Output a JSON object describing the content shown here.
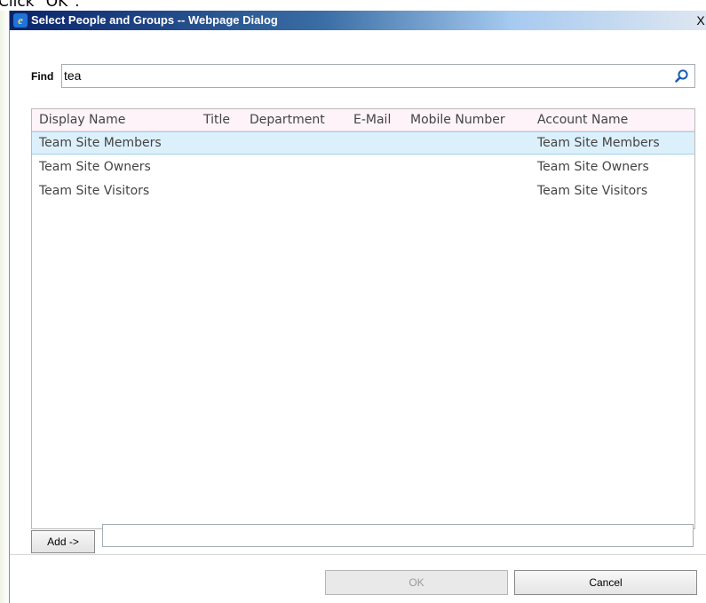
{
  "background": {
    "caption": "Click \"OK\"."
  },
  "dialog": {
    "title": "Select People and Groups -- Webpage Dialog",
    "close_glyph": "X"
  },
  "find": {
    "label": "Find",
    "value": "tea"
  },
  "results": {
    "columns": [
      "Display Name",
      "Title",
      "Department",
      "E-Mail",
      "Mobile Number",
      "Account Name"
    ],
    "rows": [
      {
        "display_name": "Team Site Members",
        "title": "",
        "department": "",
        "email": "",
        "mobile": "",
        "account": "Team Site Members",
        "selected": true
      },
      {
        "display_name": "Team Site Owners",
        "title": "",
        "department": "",
        "email": "",
        "mobile": "",
        "account": "Team Site Owners",
        "selected": false
      },
      {
        "display_name": "Team Site Visitors",
        "title": "",
        "department": "",
        "email": "",
        "mobile": "",
        "account": "Team Site Visitors",
        "selected": false
      }
    ]
  },
  "add": {
    "button_label": "Add ->",
    "value": ""
  },
  "footer": {
    "ok_label": "OK",
    "cancel_label": "Cancel"
  },
  "colors": {
    "titlebar_start": "#0a246a",
    "selected_row": "#dcf0fb",
    "header_bg": "#fdf3f8",
    "search_icon": "#1a5fb4"
  },
  "icons": {
    "window": "ie-icon",
    "search": "search-icon",
    "close": "close-icon"
  }
}
